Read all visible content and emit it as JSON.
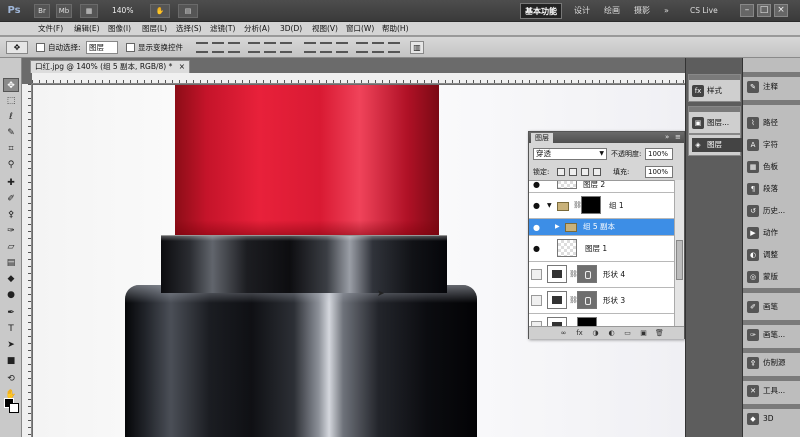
{
  "app": {
    "logo": "Ps",
    "zoom": "140%",
    "workspaces": [
      "基本功能",
      "设计",
      "绘画",
      "摄影"
    ],
    "more": "»",
    "cs_live": "CS Live",
    "window_controls": [
      "–",
      "□",
      "×"
    ]
  },
  "menu": [
    "文件(F)",
    "编辑(E)",
    "图像(I)",
    "图层(L)",
    "选择(S)",
    "滤镜(T)",
    "分析(A)",
    "3D(D)",
    "视图(V)",
    "窗口(W)",
    "帮助(H)"
  ],
  "options": {
    "auto_select_label": "自动选择:",
    "auto_select_value": "图层",
    "show_transform_label": "显示变换控件"
  },
  "document": {
    "tab_title": "口红.jpg @ 140% (组 5 副本, RGB/8) *",
    "tab_close": "×"
  },
  "layers_panel": {
    "tab": "图层",
    "collapse": "»",
    "menu": "≡",
    "blend_mode": "穿透",
    "opacity_label": "不透明度:",
    "opacity": "100%",
    "lock_label": "锁定:",
    "fill_label": "填充:",
    "fill": "100%",
    "layers": [
      {
        "name": "图层 2",
        "type": "pixel",
        "visible": true,
        "selected": false
      },
      {
        "name": "组 1",
        "type": "group",
        "visible": true,
        "selected": false
      },
      {
        "name": "组 5 副本",
        "type": "group",
        "visible": true,
        "selected": true
      },
      {
        "name": "图层 1",
        "type": "pixel",
        "visible": true,
        "selected": false
      },
      {
        "name": "形状 4",
        "type": "shape",
        "visible": false,
        "selected": false
      },
      {
        "name": "形状 3",
        "type": "shape",
        "visible": false,
        "selected": false
      },
      {
        "name": "",
        "type": "shape",
        "visible": false,
        "selected": false
      }
    ],
    "footer": [
      "∞",
      "fx",
      "◑",
      "◐",
      "▭",
      "▣",
      "🗑"
    ]
  },
  "dock_left": [
    "样式",
    "图层...",
    "图层"
  ],
  "dock_right": [
    "注释",
    "路径",
    "字符",
    "色板",
    "段落",
    "历史...",
    "动作",
    "调整",
    "蒙版",
    "画笔",
    "画笔...",
    "仿制源",
    "工具...",
    "3D"
  ]
}
